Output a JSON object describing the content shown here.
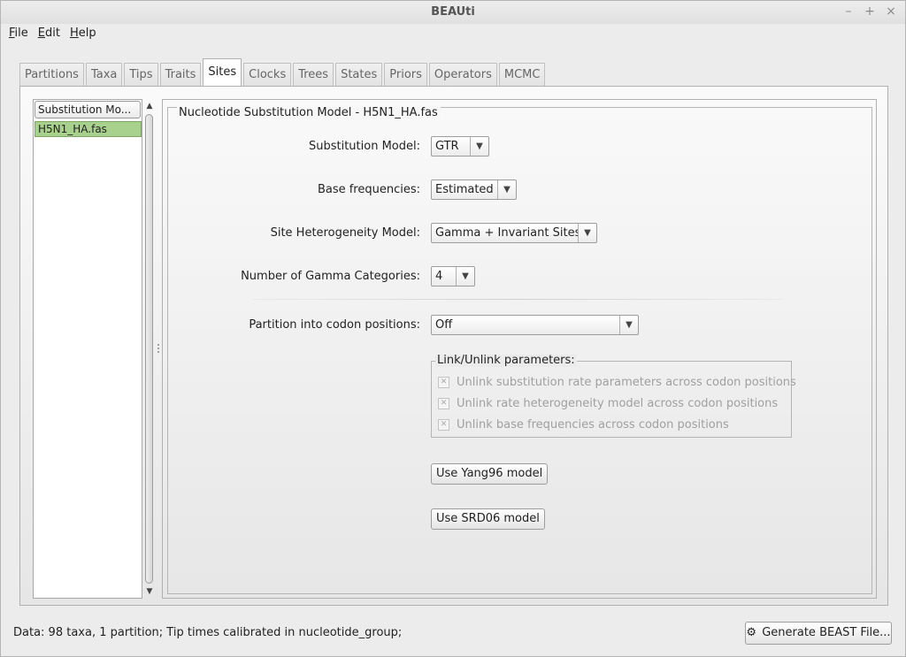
{
  "window": {
    "title": "BEAUti",
    "controls": [
      "–",
      "+",
      "×"
    ]
  },
  "menu": [
    "File",
    "Edit",
    "Help"
  ],
  "tabs": [
    "Partitions",
    "Taxa",
    "Tips",
    "Traits",
    "Sites",
    "Clocks",
    "Trees",
    "States",
    "Priors",
    "Operators",
    "MCMC"
  ],
  "active_tab": "Sites",
  "partition_list": {
    "header": "Substitution Mo...",
    "items": [
      "H5N1_HA.fas"
    ],
    "selected": "H5N1_HA.fas"
  },
  "model_panel": {
    "legend": "Nucleotide Substitution Model - H5N1_HA.fas",
    "substitution_model": {
      "label": "Substitution Model:",
      "value": "GTR"
    },
    "base_frequencies": {
      "label": "Base frequencies:",
      "value": "Estimated"
    },
    "site_heterogeneity": {
      "label": "Site Heterogeneity Model:",
      "value": "Gamma + Invariant Sites"
    },
    "gamma_categories": {
      "label": "Number of Gamma Categories:",
      "value": "4"
    },
    "codon_partition": {
      "label": "Partition into codon positions:",
      "value": "Off"
    },
    "link_group": {
      "legend": "Link/Unlink parameters:",
      "options": [
        "Unlink substitution rate parameters across codon positions",
        "Unlink rate heterogeneity model across codon positions",
        "Unlink base frequencies across codon positions"
      ],
      "checked_mark": "✕"
    },
    "yang_button": "Use Yang96 model",
    "srd_button": "Use SRD06 model"
  },
  "status": {
    "text": "Data: 98 taxa, 1 partition; Tip times calibrated in nucleotide_group;",
    "generate_button": "Generate BEAST File...",
    "generate_icon": "gear-icon"
  },
  "glyphs": {
    "dropdown_arrow": "▼",
    "scroll_up": "▲",
    "scroll_down": "▼"
  }
}
